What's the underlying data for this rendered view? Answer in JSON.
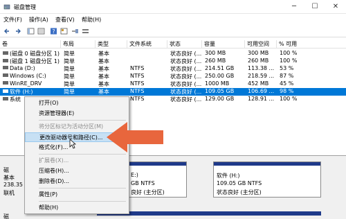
{
  "window": {
    "title": "磁盘管理",
    "minimize": "─",
    "maximize": "☐",
    "close": "✕"
  },
  "menu": [
    "文件(F)",
    "操作(A)",
    "查看(V)",
    "帮助(H)"
  ],
  "table": {
    "columns": [
      "卷",
      "布局",
      "类型",
      "文件系统",
      "状态",
      "容量",
      "可用空间",
      "% 可用"
    ],
    "rows": [
      {
        "name": "(磁盘 0 磁盘分区 1)",
        "layout": "简单",
        "type": "基本",
        "fs": "",
        "status": "状态良好 (...",
        "capacity": "300 MB",
        "free": "300 MB",
        "pct": "100 %"
      },
      {
        "name": "(磁盘 1 磁盘分区 1)",
        "layout": "简单",
        "type": "基本",
        "fs": "",
        "status": "状态良好 (...",
        "capacity": "260 MB",
        "free": "260 MB",
        "pct": "100 %"
      },
      {
        "name": "Data (D:)",
        "layout": "简单",
        "type": "基本",
        "fs": "NTFS",
        "status": "状态良好 (...",
        "capacity": "214.51 GB",
        "free": "113.38 ...",
        "pct": "53 %"
      },
      {
        "name": "Windows (C:)",
        "layout": "简单",
        "type": "基本",
        "fs": "NTFS",
        "status": "状态良好 (...",
        "capacity": "250.00 GB",
        "free": "218.59 ...",
        "pct": "87 %"
      },
      {
        "name": "WinRE_DRV",
        "layout": "简单",
        "type": "基本",
        "fs": "NTFS",
        "status": "状态良好 (...",
        "capacity": "1000 MB",
        "free": "452 MB",
        "pct": "45 %"
      },
      {
        "name": "软件 (H:)",
        "layout": "简单",
        "type": "基本",
        "fs": "NTFS",
        "status": "状态良好 (...",
        "capacity": "109.05 GB",
        "free": "106.69 ...",
        "pct": "98 %"
      },
      {
        "name": "系统",
        "layout": "简单",
        "type": "基本",
        "fs": "NTFS",
        "status": "状态良好 (...",
        "capacity": "129.00 GB",
        "free": "128.91 ...",
        "pct": "100 %"
      }
    ]
  },
  "context_menu": {
    "open": "打开(O)",
    "explore": "资源管理器(E)",
    "mark_active": "将分区标记为活动分区(M)",
    "change_letter": "更改驱动器号和路径(C)...",
    "format": "格式化(F)...",
    "extend": "扩展卷(X)...",
    "shrink": "压缩卷(H)...",
    "delete": "删除卷(D)...",
    "properties": "属性(P)",
    "help": "帮助(H)"
  },
  "lower": {
    "disk0_label": "磁",
    "disk0_type": "基本",
    "disk0_size": "238.35",
    "disk0_status": "联机",
    "disk1_label": "磁",
    "part_mid_title": "E:)",
    "part_mid_size": "GB NTFS",
    "part_mid_status": "良好 (主分区)",
    "part_h_title": "软件  (H:)",
    "part_h_size": "109.05 GB NTFS",
    "part_h_status": "状态良好 (主分区)"
  },
  "colors": {
    "selection": "#0078d7",
    "arrow": "#e8663d",
    "partition_bar": "#1f3a8a"
  }
}
